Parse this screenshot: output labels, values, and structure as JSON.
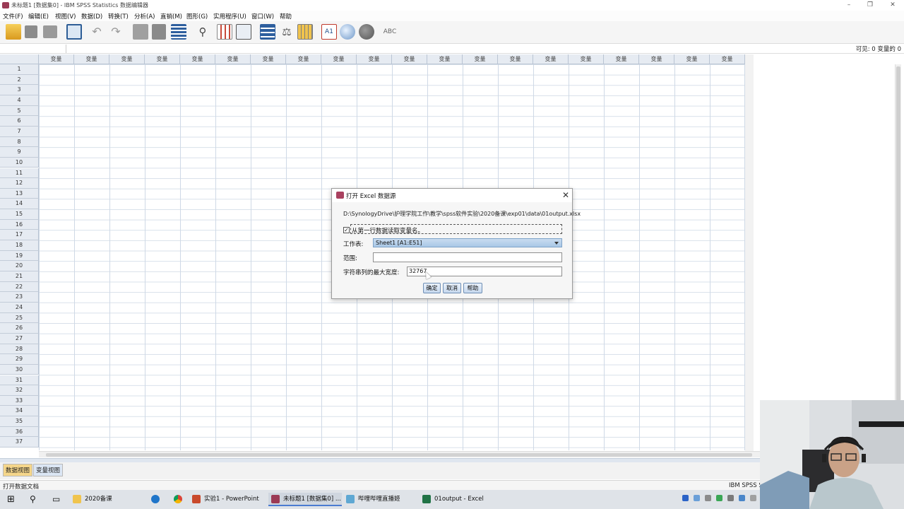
{
  "window": {
    "title": "未标题1 [数据集0] - IBM SPSS Statistics 数据编辑器",
    "min": "–",
    "max": "❐",
    "close": "✕"
  },
  "menu": [
    "文件(F)",
    "编辑(E)",
    "视图(V)",
    "数据(D)",
    "转换(T)",
    "分析(A)",
    "直销(M)",
    "图形(G)",
    "实用程序(U)",
    "窗口(W)",
    "帮助"
  ],
  "toolbar": {
    "icons": [
      "open-icon",
      "save-icon",
      "print-icon",
      "recall-dialog-icon",
      "undo-icon",
      "redo-icon",
      "goto-case-icon",
      "goto-variable-icon",
      "variables-icon",
      "find-icon",
      "insert-cases-icon",
      "insert-variable-icon",
      "split-file-icon",
      "weight-cases-icon",
      "select-cases-icon",
      "value-labels-icon",
      "use-sets-icon",
      "show-all-variables-icon",
      "spellcheck-icon"
    ]
  },
  "editbar": {
    "visible": "可见: 0 变量的 0"
  },
  "grid": {
    "column_header": "变量",
    "column_count": 20,
    "rows": [
      "1",
      "2",
      "3",
      "4",
      "5",
      "6",
      "7",
      "8",
      "9",
      "10",
      "11",
      "12",
      "13",
      "14",
      "15",
      "16",
      "17",
      "18",
      "19",
      "20",
      "21",
      "22",
      "23",
      "24",
      "25",
      "26",
      "27",
      "28",
      "29",
      "30",
      "31",
      "32",
      "33",
      "34",
      "35",
      "36",
      "37"
    ]
  },
  "tabs": {
    "data_view": "数据视图",
    "variable_view": "变量视图"
  },
  "status": {
    "left": "打开数据文档",
    "right": "IBM SPSS S"
  },
  "dialog": {
    "title": "打开 Excel 数据源",
    "path": "D:\\SynologyDrive\\护理学院工作\\教学\\spss软件实验\\2020备课\\exp01\\data\\01output.xlsx",
    "checkbox_label": "从第一行数据读取变量名。",
    "checkbox_checked": true,
    "sheet_label": "工作表:",
    "sheet_value": "Sheet1 [A1:E51]",
    "range_label": "范围:",
    "range_value": "",
    "width_label": "字符串列的最大宽度:",
    "width_value": "32767",
    "ok": "确定",
    "cancel": "取消",
    "help": "帮助",
    "close": "✕"
  },
  "taskbar": {
    "items": [
      {
        "label": "2020备课",
        "icon": "folder-icon"
      },
      {
        "label": "实验1 - PowerPoint",
        "icon": "powerpoint-icon"
      },
      {
        "label": "未标题1 [数据集0] ...",
        "icon": "spss-icon"
      },
      {
        "label": "哔哩哔哩直播姬",
        "icon": "bilibili-icon"
      },
      {
        "label": "01output - Excel",
        "icon": "excel-icon"
      }
    ]
  },
  "colors": {
    "header_bg": "#e6ebf2",
    "active_tab": "#f5d68a",
    "dialog_sheet": "#b7d0ea",
    "spss_icon": "#9b3a55"
  }
}
